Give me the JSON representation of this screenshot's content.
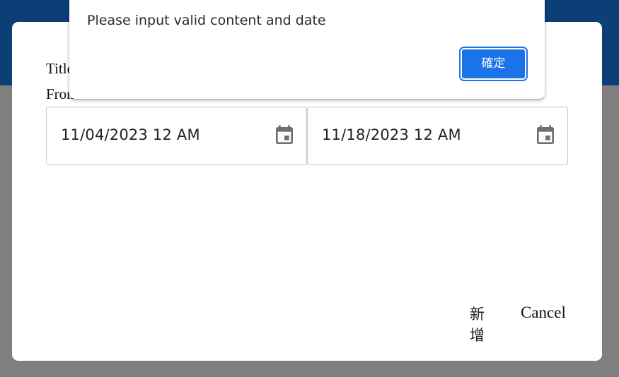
{
  "dialog": {
    "title_label": "Title",
    "from_label": "From",
    "date_from": "11/04/2023 12 AM",
    "date_to": "11/18/2023 12 AM",
    "add_label": "新增",
    "cancel_label": "Cancel"
  },
  "alert": {
    "message": "Please input valid content and date",
    "ok_label": "確定"
  },
  "icons": {
    "calendar": "calendar-icon"
  },
  "colors": {
    "header": "#0d3f77",
    "backdrop": "#7f7f7f",
    "primary": "#1a73e8"
  }
}
